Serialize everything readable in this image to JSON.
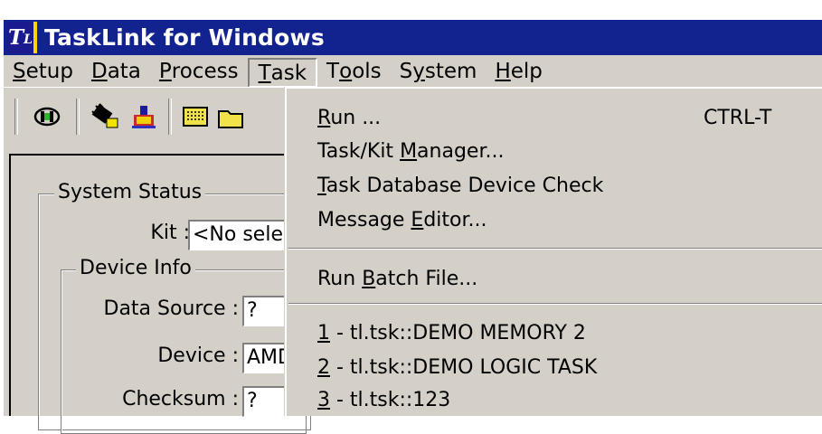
{
  "window": {
    "icon_text": "T",
    "icon_sub": "L",
    "title": "TaskLink for Windows"
  },
  "menubar": {
    "items": [
      {
        "pre": "",
        "ul": "S",
        "post": "etup"
      },
      {
        "pre": "",
        "ul": "D",
        "post": "ata"
      },
      {
        "pre": "",
        "ul": "P",
        "post": "rocess"
      },
      {
        "pre": "",
        "ul": "T",
        "post": "ask"
      },
      {
        "pre": "T",
        "ul": "o",
        "post": "ols"
      },
      {
        "pre": "S",
        "ul": "y",
        "post": "stem"
      },
      {
        "pre": "",
        "ul": "H",
        "post": "elp"
      }
    ]
  },
  "toolbar": {
    "icons": [
      "connect-icon",
      "programmer-icon",
      "device-icon",
      "chip-icon",
      "open-folder-icon"
    ]
  },
  "status": {
    "system_status_label": "System Status",
    "kit_label": "Kit :",
    "kit_value": "<No selec",
    "device_info_label": "Device Info",
    "data_source_label": "Data Source :",
    "data_source_value": "?",
    "device_label": "Device :",
    "device_value": "AMD",
    "checksum_label": "Checksum :",
    "checksum_value": "?"
  },
  "task_menu": {
    "run": {
      "pre": "",
      "ul": "R",
      "post": "un ...",
      "shortcut": "CTRL-T"
    },
    "kit_manager": {
      "pre": "Task/Kit ",
      "ul": "M",
      "post": "anager..."
    },
    "db_check": {
      "pre": "",
      "ul": "T",
      "post": "ask Database Device Check"
    },
    "message_editor": {
      "pre": "Message ",
      "ul": "E",
      "post": "ditor..."
    },
    "batch": {
      "pre": "Run ",
      "ul": "B",
      "post": "atch File..."
    },
    "recent": [
      {
        "ul": "1",
        "post": " - tl.tsk::DEMO MEMORY 2"
      },
      {
        "ul": "2",
        "post": " - tl.tsk::DEMO LOGIC TASK"
      },
      {
        "ul": "3",
        "post": " - tl.tsk::123"
      }
    ]
  },
  "colors": {
    "titlebar": "#12238f",
    "face": "#d4d0c8",
    "accent_icon": "#ffd400"
  }
}
